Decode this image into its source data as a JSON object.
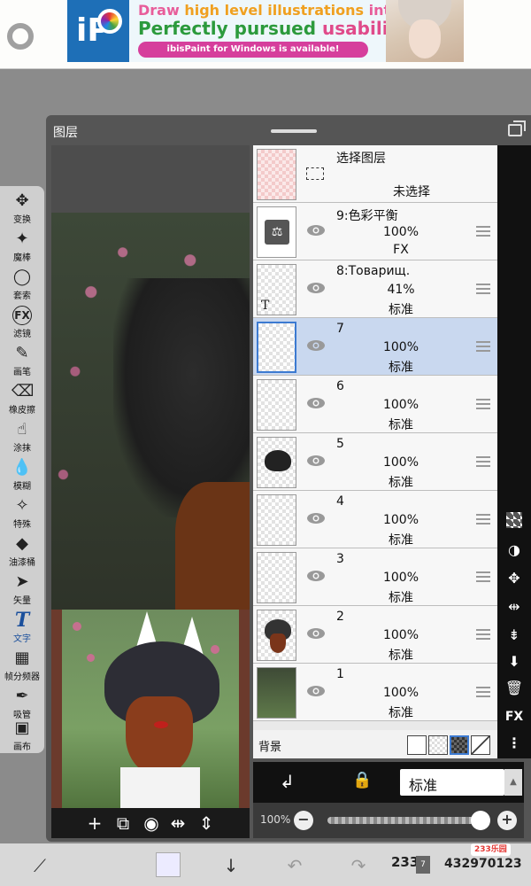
{
  "ad": {
    "logo_text": "iP",
    "line1_a": "Draw ",
    "line1_b": "high level illustrations",
    "line1_c": " intuitively!",
    "line2_a": "Perfectly pursued ",
    "line2_b": "usability!",
    "line3": "ibisPaint for Windows is available!"
  },
  "panel": {
    "title": "图层"
  },
  "tools": [
    {
      "icon": "✥",
      "label": "变换"
    },
    {
      "icon": "✦",
      "label": "魔棒"
    },
    {
      "icon": "◯",
      "label": "套索"
    },
    {
      "icon": "FX",
      "label": "滤镜"
    },
    {
      "icon": "✎",
      "label": "画笔"
    },
    {
      "icon": "⌫",
      "label": "橡皮擦"
    },
    {
      "icon": "☝",
      "label": "涂抹"
    },
    {
      "icon": "💧",
      "label": "模糊"
    },
    {
      "icon": "✧",
      "label": "特殊"
    },
    {
      "icon": "◆",
      "label": "油漆桶"
    },
    {
      "icon": "➤",
      "label": "矢量"
    },
    {
      "icon": "T",
      "label": "文字"
    },
    {
      "icon": "▦",
      "label": "帧分频器"
    },
    {
      "icon": "✒",
      "label": "吸管"
    },
    {
      "icon": "▣",
      "label": "画布"
    }
  ],
  "select_layer": {
    "title": "选择图层",
    "status": "未选择"
  },
  "layers": [
    {
      "name": "9:色彩平衡",
      "opacity": "100%",
      "mode": "FX"
    },
    {
      "name": "8:Товарищ.",
      "opacity": "41%",
      "mode": "标准"
    },
    {
      "name": "7",
      "opacity": "100%",
      "mode": "标准",
      "selected": true
    },
    {
      "name": "6",
      "opacity": "100%",
      "mode": "标准"
    },
    {
      "name": "5",
      "opacity": "100%",
      "mode": "标准"
    },
    {
      "name": "4",
      "opacity": "100%",
      "mode": "标准"
    },
    {
      "name": "3",
      "opacity": "100%",
      "mode": "标准"
    },
    {
      "name": "2",
      "opacity": "100%",
      "mode": "标准"
    },
    {
      "name": "1",
      "opacity": "100%",
      "mode": "标准"
    }
  ],
  "background_row": {
    "label": "背景"
  },
  "right_strip": [
    "checker-icon",
    "mask-icon",
    "move-icon",
    "flip-icon",
    "merge-icon",
    "download-icon",
    "trash-icon",
    "FX",
    "more-icon"
  ],
  "blend": {
    "mode": "标准"
  },
  "opacity_bar": {
    "value": "100%",
    "minus": "−",
    "plus": "+"
  },
  "bottom": {
    "layer_number": "233",
    "layer_badge": "7",
    "watermark_tag": "233乐园",
    "watermark_id": "432970123"
  }
}
